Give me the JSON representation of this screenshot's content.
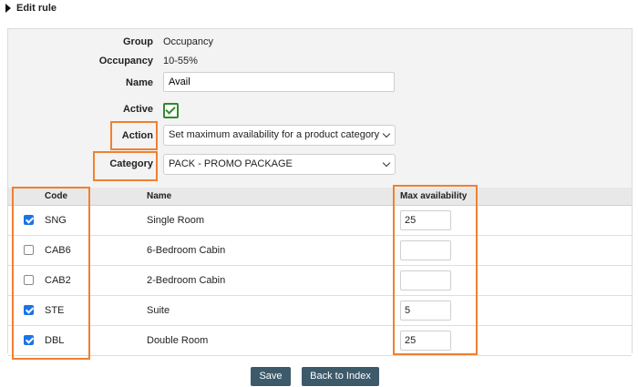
{
  "header": {
    "title": "Edit rule"
  },
  "form": {
    "group": {
      "label": "Group",
      "value": "Occupancy"
    },
    "occupancy": {
      "label": "Occupancy",
      "value": "10-55%"
    },
    "name": {
      "label": "Name",
      "value": "Avail"
    },
    "active": {
      "label": "Active",
      "checked": true
    },
    "action": {
      "label": "Action",
      "selected": "Set maximum availability for a product category"
    },
    "category": {
      "label": "Category",
      "selected": "PACK - PROMO PACKAGE"
    }
  },
  "table": {
    "columns": {
      "code": "Code",
      "name": "Name",
      "max": "Max availability"
    },
    "rows": [
      {
        "checked": true,
        "code": "SNG",
        "name": "Single Room",
        "max": "25"
      },
      {
        "checked": false,
        "code": "CAB6",
        "name": "6-Bedroom Cabin",
        "max": ""
      },
      {
        "checked": false,
        "code": "CAB2",
        "name": "2-Bedroom Cabin",
        "max": ""
      },
      {
        "checked": true,
        "code": "STE",
        "name": "Suite",
        "max": "5"
      },
      {
        "checked": true,
        "code": "DBL",
        "name": "Double Room",
        "max": "25"
      }
    ]
  },
  "buttons": {
    "save": "Save",
    "back": "Back to Index"
  },
  "colors": {
    "highlight": "#f08030",
    "button": "#3d5a6b",
    "check_blue": "#1a73e8",
    "check_green": "#2e8b2e"
  }
}
